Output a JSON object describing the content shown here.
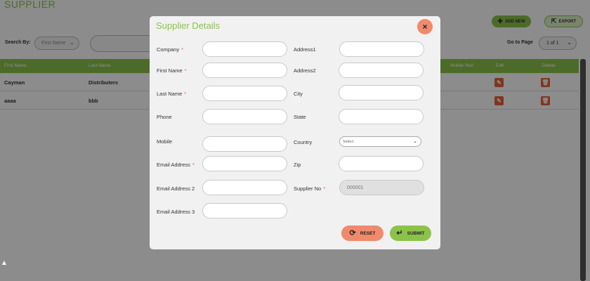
{
  "page": {
    "title": "SUPPLIER",
    "add_new_label": "ADD NEW",
    "export_label": "EXPORT",
    "search_by_label": "Search By:",
    "search_by_value": "First Name",
    "go_to_page_label": "Go to Page",
    "page_value": "1 of 1"
  },
  "grid": {
    "columns": [
      "First Name",
      "Last Name",
      "Mobile No#",
      "Edit",
      "Delete"
    ],
    "rows": [
      {
        "first_name": "Cayman",
        "last_name": "Distributers"
      },
      {
        "first_name": "aaaa",
        "last_name": "bbb"
      }
    ]
  },
  "modal": {
    "title": "Supplier Details",
    "close_symbol": "×",
    "fields": {
      "company": {
        "label": "Company",
        "required": "*",
        "value": ""
      },
      "first_name": {
        "label": "First Name",
        "required": "*",
        "value": ""
      },
      "last_name": {
        "label": "Last Name",
        "required": "*",
        "value": ""
      },
      "phone": {
        "label": "Phone",
        "value": ""
      },
      "mobile": {
        "label": "Mobile",
        "value": ""
      },
      "email1": {
        "label": "Email Address",
        "required": "*",
        "value": ""
      },
      "email2": {
        "label": "Email Address 2",
        "value": ""
      },
      "email3": {
        "label": "Email Address 3",
        "value": ""
      },
      "address1": {
        "label": "Address1",
        "value": ""
      },
      "address2": {
        "label": "Address2",
        "value": ""
      },
      "city": {
        "label": "City",
        "value": ""
      },
      "state": {
        "label": "State",
        "value": ""
      },
      "country": {
        "label": "Country",
        "value": "Select"
      },
      "zip": {
        "label": "Zip",
        "value": ""
      },
      "supplier_no": {
        "label": "Supplier No",
        "required": "*",
        "placeholder": "000001"
      }
    },
    "reset_label": "RESET",
    "submit_label": "SUBMIT"
  },
  "icons": {
    "add": "plus-icon",
    "export": "export-icon",
    "edit": "edit-icon",
    "delete": "trash-icon",
    "close": "close-icon",
    "reset": "refresh-icon",
    "submit": "enter-icon"
  },
  "colors": {
    "accent": "#8bc34a",
    "danger": "#e8633a",
    "reset": "#f08a6c"
  }
}
